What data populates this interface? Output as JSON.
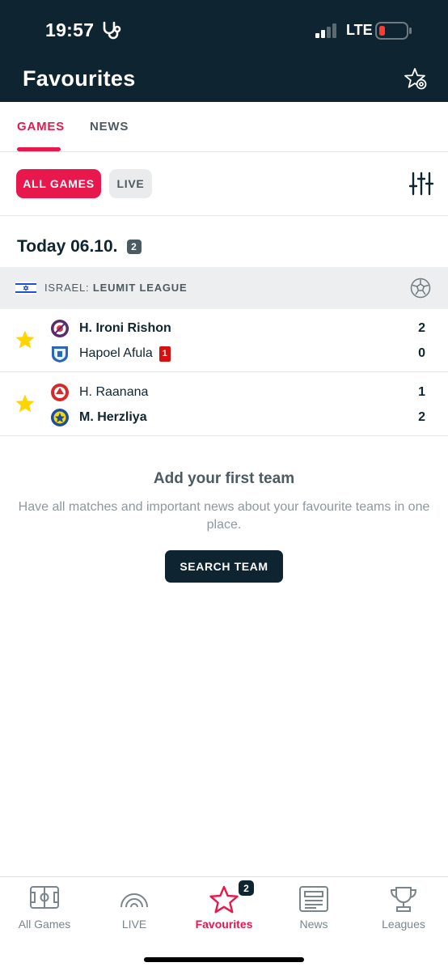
{
  "status_bar": {
    "time": "19:57",
    "network": "LTE"
  },
  "header": {
    "title": "Favourites"
  },
  "tabs": [
    {
      "label": "GAMES",
      "active": true
    },
    {
      "label": "NEWS",
      "active": false
    }
  ],
  "filters": {
    "all_games": "ALL GAMES",
    "live": "LIVE"
  },
  "date_section": {
    "label": "Today 06.10.",
    "count": "2"
  },
  "league": {
    "country": "ISRAEL:",
    "name": "LEUMIT LEAGUE"
  },
  "matches": [
    {
      "home": {
        "name": "H. Ironi Rishon",
        "score": "2",
        "winner": true
      },
      "away": {
        "name": "Hapoel Afula",
        "score": "0",
        "winner": false,
        "red_cards": "1"
      }
    },
    {
      "home": {
        "name": "H. Raanana",
        "score": "1",
        "winner": false
      },
      "away": {
        "name": "M. Herzliya",
        "score": "2",
        "winner": true
      }
    }
  ],
  "empty_state": {
    "title": "Add your first team",
    "description": "Have all matches and important news about your favourite teams in one place.",
    "button": "SEARCH TEAM"
  },
  "bottom_nav": {
    "items": [
      {
        "label": "All Games",
        "icon": "pitch-icon"
      },
      {
        "label": "LIVE",
        "icon": "live-icon"
      },
      {
        "label": "Favourites",
        "icon": "star-icon",
        "badge": "2",
        "active": true
      },
      {
        "label": "News",
        "icon": "news-icon"
      },
      {
        "label": "Leagues",
        "icon": "trophy-icon"
      }
    ]
  },
  "colors": {
    "accent": "#e8174c",
    "header": "#0e2430",
    "fav_star": "#ffd500",
    "red_card": "#d70f0f"
  }
}
